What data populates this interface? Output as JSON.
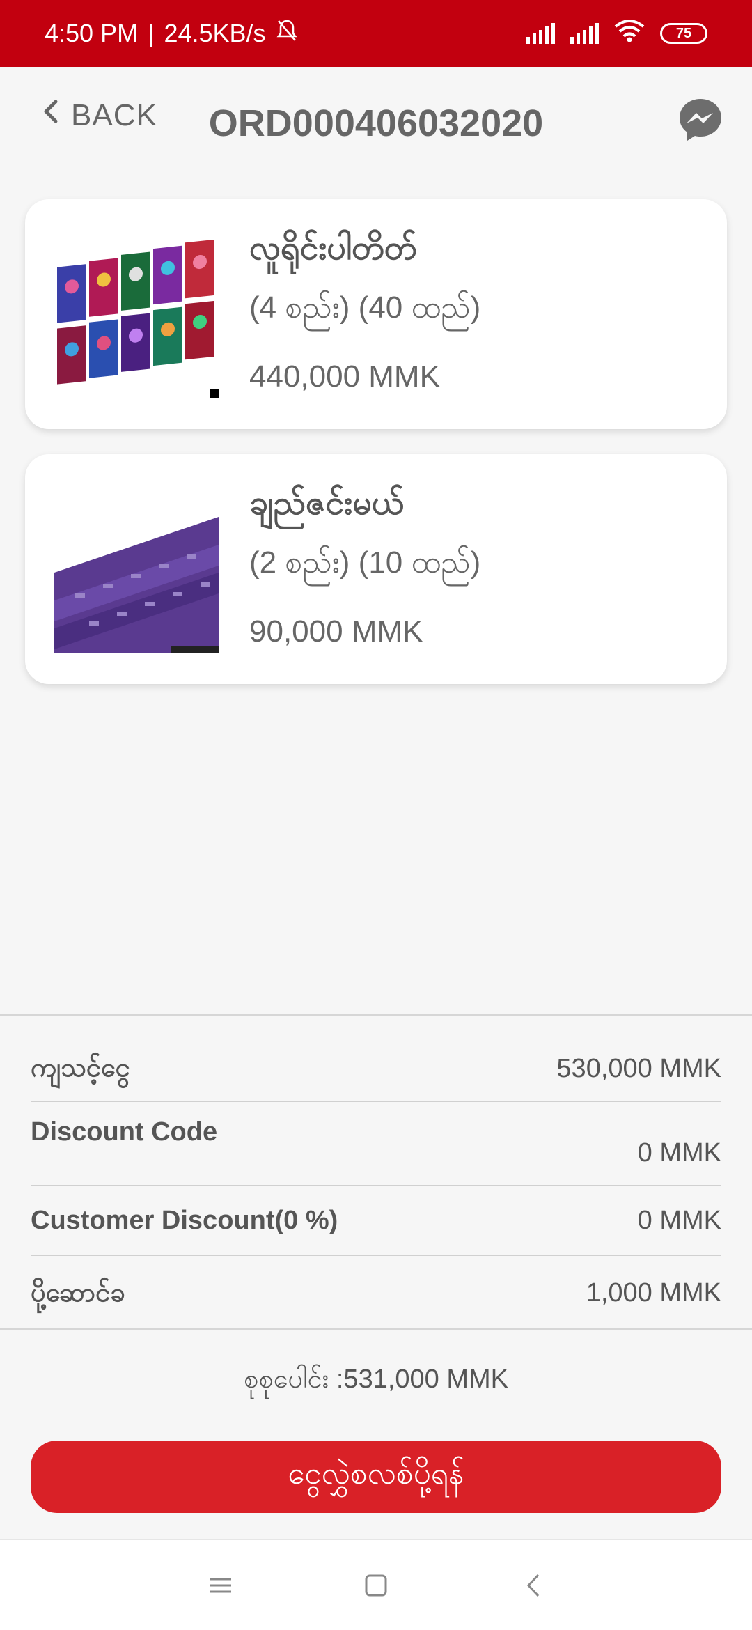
{
  "status_bar": {
    "time": "4:50 PM",
    "network_speed": "24.5KB/s",
    "battery": "75",
    "color": "#c2000f"
  },
  "header": {
    "back_label": "BACK",
    "order_id": "ORD000406032020",
    "chat_icon": "messenger-icon"
  },
  "items": [
    {
      "name": "လူရိုင်းပါတိတ်",
      "quantity": "(4 စည်း) (40 ထည်)",
      "price": "440,000 MMK"
    },
    {
      "name": "ချည်ဇင်းမယ်",
      "quantity": "(2 စည်း) (10 ထည်)",
      "price": "90,000 MMK"
    }
  ],
  "summary": {
    "subtotal_label": "ကျသင့်ငွေ",
    "subtotal_value": "530,000 MMK",
    "discount_code_label": "Discount Code",
    "discount_code_value": "0 MMK",
    "customer_discount_label": "Customer Discount(0 %)",
    "customer_discount_value": "0 MMK",
    "delivery_label": "ပို့ဆောင်ခ",
    "delivery_value": "1,000 MMK"
  },
  "total": "စုစုပေါင်း :531,000 MMK",
  "confirm_button": "ငွေလွှဲစလစ်ပို့ရန်",
  "accent_color": "#d92127"
}
